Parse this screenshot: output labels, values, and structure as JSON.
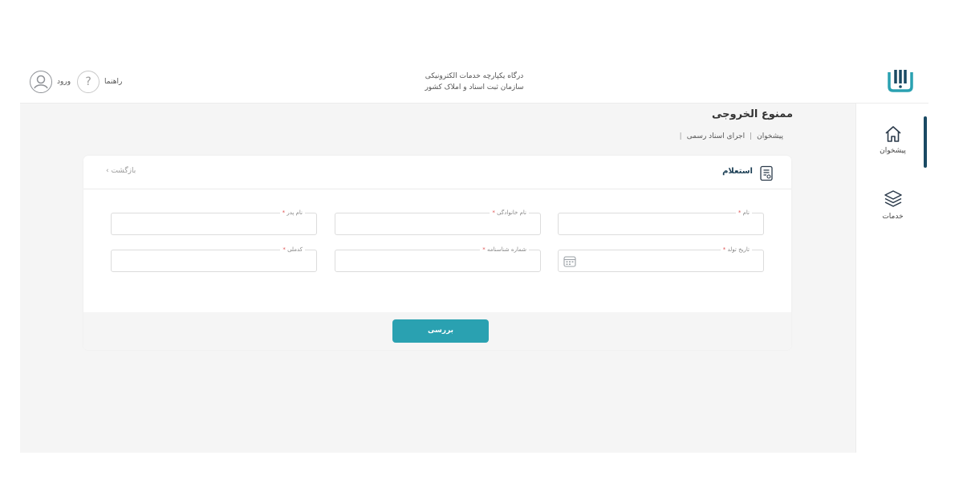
{
  "header": {
    "title_line1": "درگاه یکپارچه خدمات الکترونیکی",
    "title_line2": "سازمان ثبت اسناد و املاک کشور",
    "login": "ورود",
    "help": "راهنما",
    "help_symbol": "?"
  },
  "sidebar": {
    "items": [
      {
        "label": "پیشخوان",
        "icon": "home-icon"
      },
      {
        "label": "خدمات",
        "icon": "layers-icon"
      }
    ]
  },
  "main": {
    "title": "ممنوع الخروجی",
    "breadcrumb": [
      "پیشخوان",
      "اجرای اسناد رسمی"
    ],
    "breadcrumb_sep": "|"
  },
  "card": {
    "title": "استعلام",
    "back": "بازگشت ›",
    "fields": [
      {
        "label": "نام",
        "required": "*",
        "value": ""
      },
      {
        "label": "نام خانوادگی",
        "required": "*",
        "value": ""
      },
      {
        "label": "نام پدر",
        "required": "*",
        "value": ""
      },
      {
        "label": "تاریخ تولد",
        "required": "*",
        "value": ""
      },
      {
        "label": "شماره شناسنامه",
        "required": "*",
        "value": ""
      },
      {
        "label": "کدملی",
        "required": "*",
        "value": ""
      }
    ],
    "submit": "بررسی"
  },
  "colors": {
    "accent": "#2aa1b1",
    "brand_dark": "#1a4a63",
    "required": "#e05252",
    "background": "#f5f5f5"
  }
}
